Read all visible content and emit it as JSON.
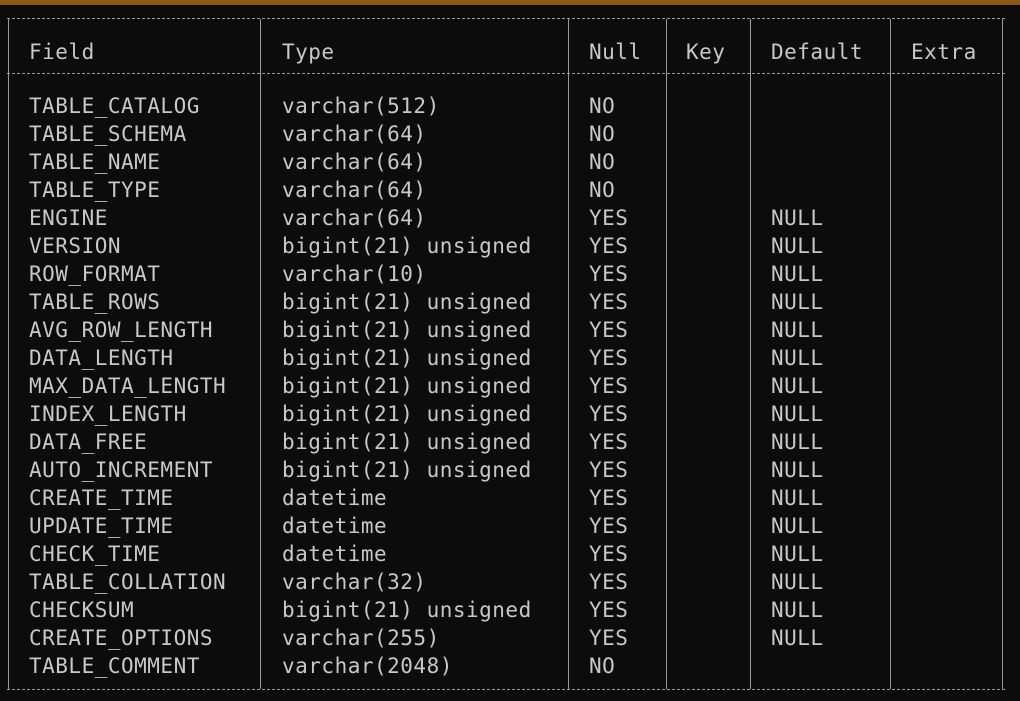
{
  "columns": {
    "field": "Field",
    "type": "Type",
    "null": "Null",
    "key": "Key",
    "default": "Default",
    "extra": "Extra"
  },
  "rows": [
    {
      "field": "TABLE_CATALOG",
      "type": "varchar(512)",
      "null": "NO",
      "key": "",
      "default": "",
      "extra": ""
    },
    {
      "field": "TABLE_SCHEMA",
      "type": "varchar(64)",
      "null": "NO",
      "key": "",
      "default": "",
      "extra": ""
    },
    {
      "field": "TABLE_NAME",
      "type": "varchar(64)",
      "null": "NO",
      "key": "",
      "default": "",
      "extra": ""
    },
    {
      "field": "TABLE_TYPE",
      "type": "varchar(64)",
      "null": "NO",
      "key": "",
      "default": "",
      "extra": ""
    },
    {
      "field": "ENGINE",
      "type": "varchar(64)",
      "null": "YES",
      "key": "",
      "default": "NULL",
      "extra": ""
    },
    {
      "field": "VERSION",
      "type": "bigint(21) unsigned",
      "null": "YES",
      "key": "",
      "default": "NULL",
      "extra": ""
    },
    {
      "field": "ROW_FORMAT",
      "type": "varchar(10)",
      "null": "YES",
      "key": "",
      "default": "NULL",
      "extra": ""
    },
    {
      "field": "TABLE_ROWS",
      "type": "bigint(21) unsigned",
      "null": "YES",
      "key": "",
      "default": "NULL",
      "extra": ""
    },
    {
      "field": "AVG_ROW_LENGTH",
      "type": "bigint(21) unsigned",
      "null": "YES",
      "key": "",
      "default": "NULL",
      "extra": ""
    },
    {
      "field": "DATA_LENGTH",
      "type": "bigint(21) unsigned",
      "null": "YES",
      "key": "",
      "default": "NULL",
      "extra": ""
    },
    {
      "field": "MAX_DATA_LENGTH",
      "type": "bigint(21) unsigned",
      "null": "YES",
      "key": "",
      "default": "NULL",
      "extra": ""
    },
    {
      "field": "INDEX_LENGTH",
      "type": "bigint(21) unsigned",
      "null": "YES",
      "key": "",
      "default": "NULL",
      "extra": ""
    },
    {
      "field": "DATA_FREE",
      "type": "bigint(21) unsigned",
      "null": "YES",
      "key": "",
      "default": "NULL",
      "extra": ""
    },
    {
      "field": "AUTO_INCREMENT",
      "type": "bigint(21) unsigned",
      "null": "YES",
      "key": "",
      "default": "NULL",
      "extra": ""
    },
    {
      "field": "CREATE_TIME",
      "type": "datetime",
      "null": "YES",
      "key": "",
      "default": "NULL",
      "extra": ""
    },
    {
      "field": "UPDATE_TIME",
      "type": "datetime",
      "null": "YES",
      "key": "",
      "default": "NULL",
      "extra": ""
    },
    {
      "field": "CHECK_TIME",
      "type": "datetime",
      "null": "YES",
      "key": "",
      "default": "NULL",
      "extra": ""
    },
    {
      "field": "TABLE_COLLATION",
      "type": "varchar(32)",
      "null": "YES",
      "key": "",
      "default": "NULL",
      "extra": ""
    },
    {
      "field": "CHECKSUM",
      "type": "bigint(21) unsigned",
      "null": "YES",
      "key": "",
      "default": "NULL",
      "extra": ""
    },
    {
      "field": "CREATE_OPTIONS",
      "type": "varchar(255)",
      "null": "YES",
      "key": "",
      "default": "NULL",
      "extra": ""
    },
    {
      "field": "TABLE_COMMENT",
      "type": "varchar(2048)",
      "null": "NO",
      "key": "",
      "default": "",
      "extra": ""
    }
  ],
  "colors": {
    "background": "#0c0c0c",
    "text": "#c8c8c8",
    "border": "#9a9a9a",
    "title_bar": "#8a5a16"
  }
}
